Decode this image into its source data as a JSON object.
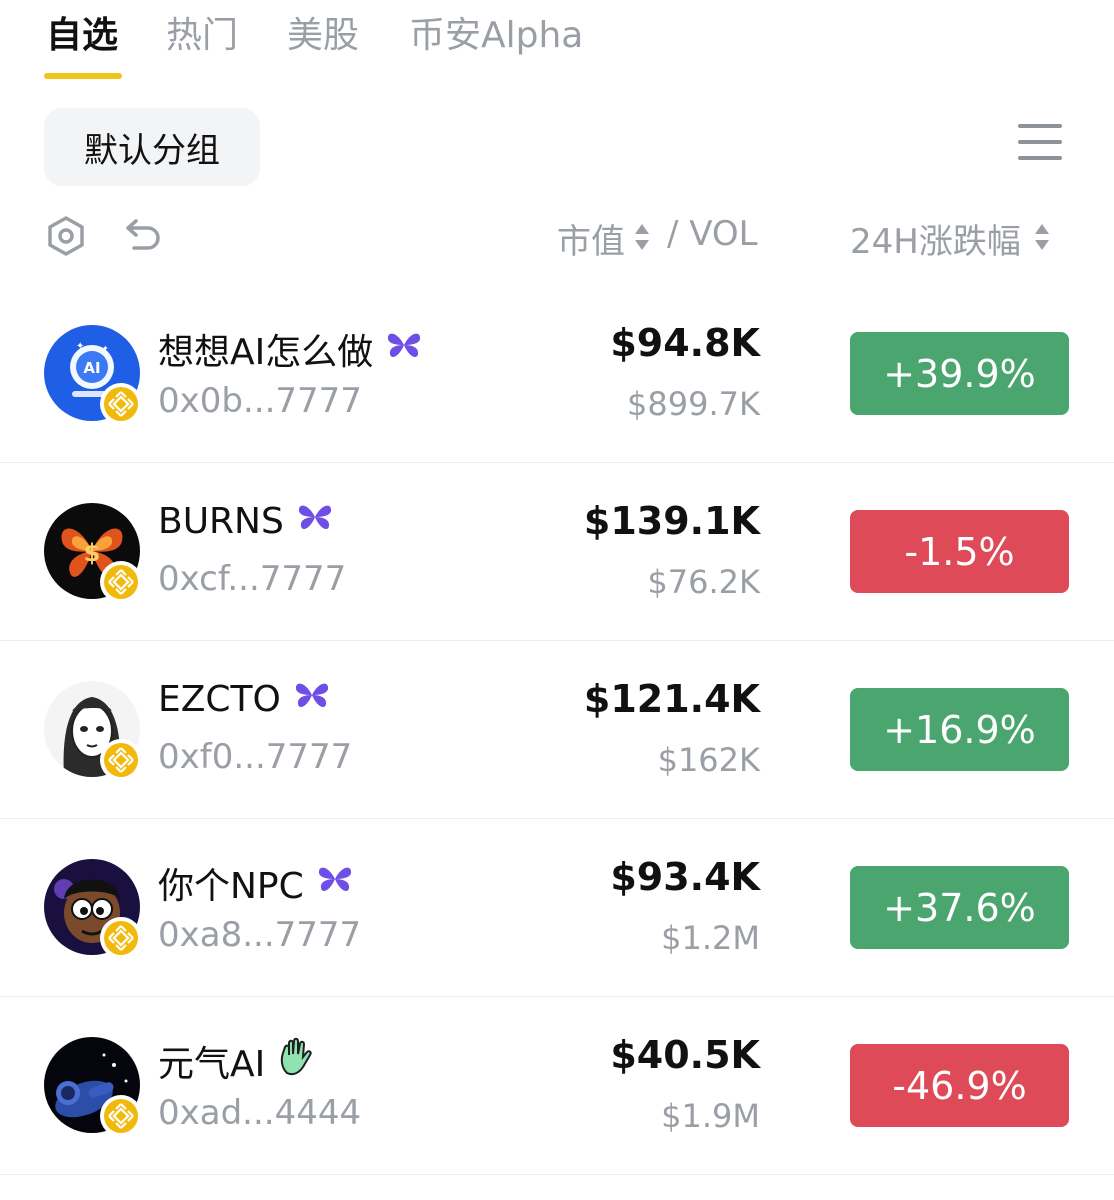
{
  "tabs": [
    {
      "label": "自选",
      "active": true
    },
    {
      "label": "热门",
      "active": false
    },
    {
      "label": "美股",
      "active": false
    },
    {
      "label": "币安Alpha",
      "active": false
    }
  ],
  "group_chip": {
    "label": "默认分组"
  },
  "header": {
    "mcap_label": "市值",
    "vol_label": "/ VOL",
    "change_label": "24H涨跌幅"
  },
  "colors": {
    "accent": "#f0c419",
    "up": "#4aa56f",
    "down": "#de4a57",
    "muted": "#9a9ea5",
    "badge_purple": "#6e4ee6",
    "bnb": "#f0b90b"
  },
  "tokens": [
    {
      "name": "想想AI怎么做",
      "badge_icon": "butterfly-icon",
      "address": "0x0b...7777",
      "mcap": "$94.8K",
      "vol": "$899.7K",
      "change": "+39.9%",
      "direction": "up",
      "avatar_icon": "ai-robot-avatar"
    },
    {
      "name": "BURNS",
      "badge_icon": "butterfly-icon",
      "address": "0xcf...7777",
      "mcap": "$139.1K",
      "vol": "$76.2K",
      "change": "-1.5%",
      "direction": "down",
      "avatar_icon": "fire-butterfly-avatar"
    },
    {
      "name": "EZCTO",
      "badge_icon": "butterfly-icon",
      "address": "0xf0...7777",
      "mcap": "$121.4K",
      "vol": "$162K",
      "change": "+16.9%",
      "direction": "up",
      "avatar_icon": "anime-girl-avatar"
    },
    {
      "name": "你个NPC",
      "badge_icon": "butterfly-icon",
      "address": "0xa8...7777",
      "mcap": "$93.4K",
      "vol": "$1.2M",
      "change": "+37.6%",
      "direction": "up",
      "avatar_icon": "cartoon-character-avatar"
    },
    {
      "name": "元气AI",
      "badge_icon": "waving-hand-icon",
      "address": "0xad...4444",
      "mcap": "$40.5K",
      "vol": "$1.9M",
      "change": "-46.9%",
      "direction": "down",
      "avatar_icon": "astronaut-avatar"
    }
  ]
}
